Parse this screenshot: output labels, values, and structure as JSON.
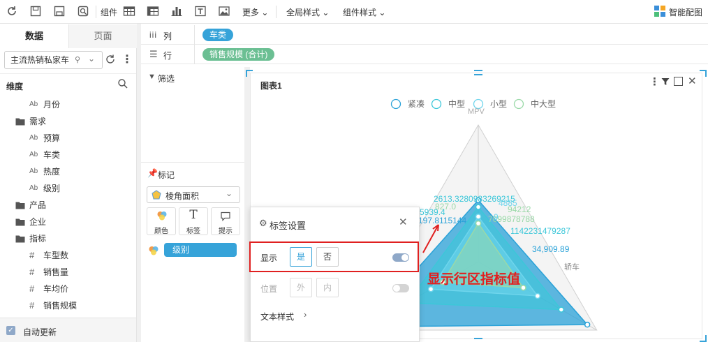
{
  "toolbar": {
    "component_label": "组件",
    "more_label": "更多",
    "global_style_label": "全局样式",
    "component_style_label": "组件样式",
    "smart_chart_label": "智能配图"
  },
  "left_panel": {
    "tabs": [
      "数据",
      "页面"
    ],
    "dataset_select": "主流热销私家车",
    "dimension_header": "维度",
    "tree": [
      {
        "type": "text",
        "label": "月份",
        "indent": 1
      },
      {
        "type": "folder",
        "label": "需求",
        "indent": 0
      },
      {
        "type": "text",
        "label": "预算",
        "indent": 1
      },
      {
        "type": "text",
        "label": "车类",
        "indent": 1
      },
      {
        "type": "text",
        "label": "热度",
        "indent": 1
      },
      {
        "type": "text",
        "label": "级别",
        "indent": 1
      },
      {
        "type": "folder",
        "label": "产品",
        "indent": 0
      },
      {
        "type": "folder",
        "label": "企业",
        "indent": 0
      },
      {
        "type": "folder",
        "label": "指标",
        "indent": 0
      },
      {
        "type": "measure",
        "label": "车型数",
        "indent": 1
      },
      {
        "type": "measure",
        "label": "销售量",
        "indent": 1
      },
      {
        "type": "measure",
        "label": "车均价",
        "indent": 1
      },
      {
        "type": "measure",
        "label": "销售规模",
        "indent": 1
      }
    ],
    "auto_update_label": "自动更新"
  },
  "shelves": {
    "column_label": "列",
    "row_label": "行",
    "column_pill": "车类",
    "row_pill": "销售规模 (合计)"
  },
  "mid_panel": {
    "filter_label": "筛选",
    "marks_label": "标记",
    "mark_type": "棱角面积",
    "mark_buttons": [
      "颜色",
      "标签",
      "提示"
    ],
    "level_pill": "级别"
  },
  "chart": {
    "title": "图表1",
    "legend": [
      "紧凑",
      "中型",
      "小型",
      "中大型"
    ],
    "axis_labels": [
      "MPV",
      "轿车"
    ],
    "data_labels": [
      "2613.3280983269215",
      "5939.4",
      "197.8115144",
      "1142231479287",
      "34,909.89",
      "827.0",
      "7099878788",
      "94212",
      "4885",
      "9"
    ],
    "annotation": "显示行区指标值"
  },
  "label_settings": {
    "title": "标签设置",
    "show_label": "显示",
    "yes": "是",
    "no": "否",
    "position_label": "位置",
    "outside": "外",
    "inside": "内",
    "text_style_label": "文本样式"
  },
  "colors": {
    "pill_blue": "#36a3d9",
    "pill_green": "#6bbf93",
    "accent_red": "#e02020",
    "series1": "#2aa2d8",
    "series2": "#3cc7d9",
    "series3": "#6fd5ec",
    "series4": "#9ad9a8"
  }
}
